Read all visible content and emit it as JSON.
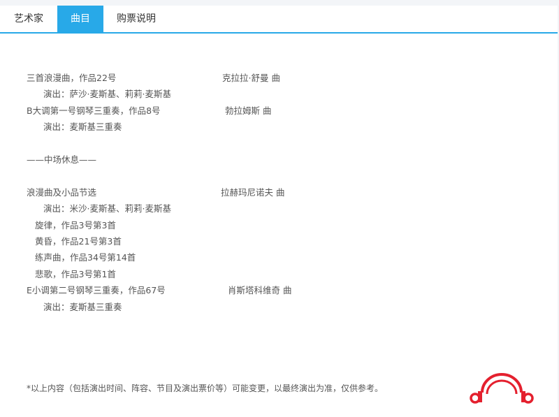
{
  "tabs": [
    {
      "label": "艺术家",
      "active": false
    },
    {
      "label": "曲目",
      "active": true
    },
    {
      "label": "购票说明",
      "active": false
    }
  ],
  "program": {
    "piece1_title": "三首浪漫曲，作品22号",
    "piece1_composer": "克拉拉·舒曼 曲",
    "piece1_perf": "演出：萨沙·麦斯基、莉莉·麦斯基",
    "piece2_title": "B大调第一号钢琴三重奏，作品8号",
    "piece2_composer": "勃拉姆斯 曲",
    "piece2_perf": "演出：麦斯基三重奏",
    "intermission": "——中场休息——",
    "piece3_title": "浪漫曲及小品节选",
    "piece3_composer": "拉赫玛尼诺夫 曲",
    "piece3_perf": "演出：米沙·麦斯基、莉莉·麦斯基",
    "piece3_item1": "旋律，作品3号第3首",
    "piece3_item2": "黄昏，作品21号第3首",
    "piece3_item3": "练声曲，作品34号第14首",
    "piece3_item4": "悲歌，作品3号第1首",
    "piece4_title": "E小调第二号钢琴三重奏，作品67号",
    "piece4_composer": "肖斯塔科维奇 曲",
    "piece4_perf": "演出：麦斯基三重奏"
  },
  "footer": {
    "note": "*以上内容（包括演出时间、阵容、节目及演出票价等）可能变更，以最终演出为准，仅供参考。"
  },
  "colors": {
    "accent": "#28a9e8",
    "logo_red": "#e4202e",
    "text": "#555555"
  },
  "icons": {
    "logo": "headphones-logo"
  }
}
